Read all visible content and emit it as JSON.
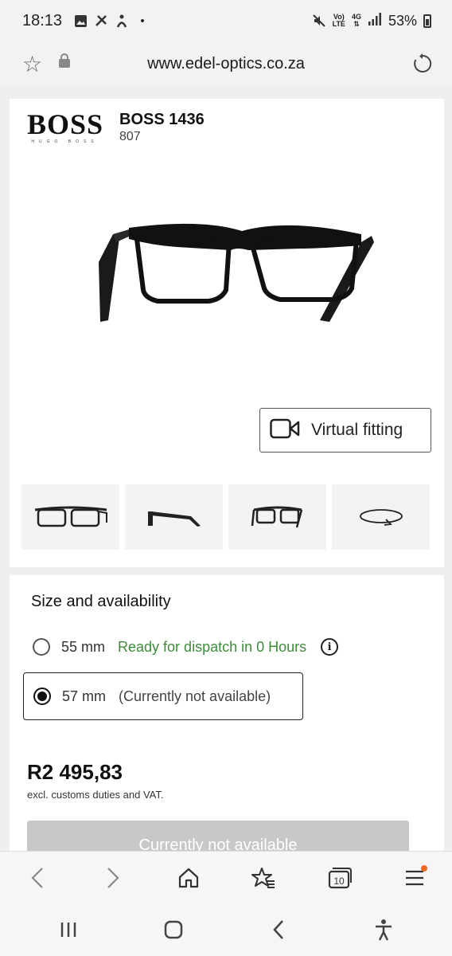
{
  "status": {
    "time": "18:13",
    "battery": "53%",
    "network_top": "Vo)",
    "network_bottom": "LTE",
    "gen": "4G"
  },
  "browser": {
    "url": "www.edel-optics.co.za"
  },
  "product": {
    "brand_logo_main": "BOSS",
    "brand_logo_sub": "HUGO BOSS",
    "name": "BOSS 1436",
    "code": "807",
    "virtual_fitting_label": "Virtual fitting"
  },
  "availability": {
    "title": "Size and availability",
    "sizes": [
      {
        "size": "55 mm",
        "status": "Ready for dispatch in 0 Hours",
        "selected": false,
        "available": true
      },
      {
        "size": "57 mm",
        "status": "(Currently not available)",
        "selected": true,
        "available": false
      }
    ],
    "price": "R2 495,83",
    "price_note": "excl. customs duties and VAT.",
    "button_label": "Currently not available"
  },
  "toolbar": {
    "tabs_count": "10"
  },
  "colors": {
    "available_green": "#3d8c3a",
    "menu_badge": "#f06a25",
    "disabled_button": "#c8c8c8"
  }
}
